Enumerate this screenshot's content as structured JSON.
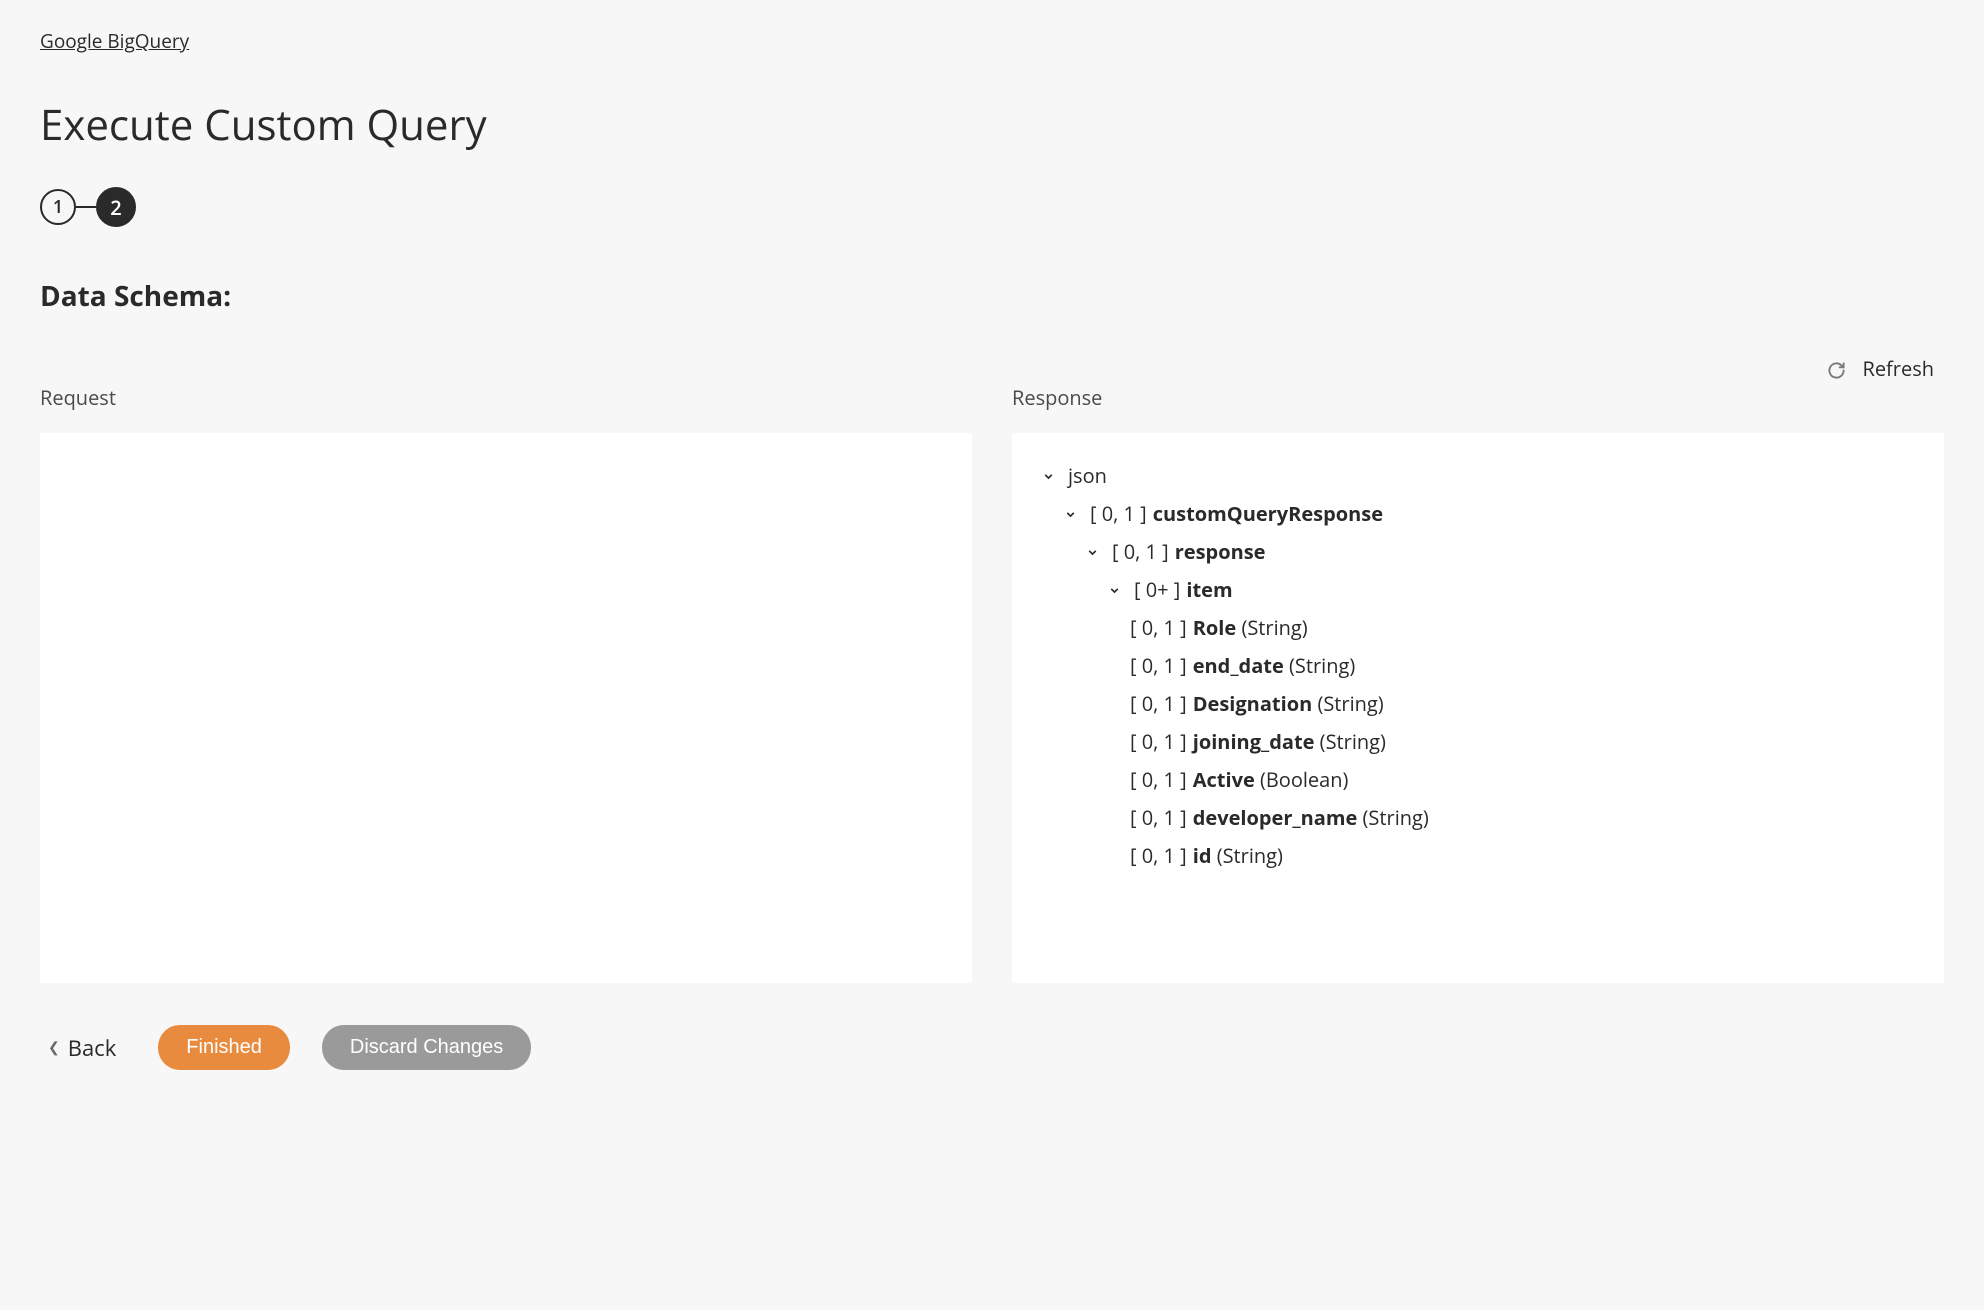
{
  "breadcrumb": "Google BigQuery",
  "page_title": "Execute Custom Query",
  "stepper": {
    "step1": "1",
    "step2": "2"
  },
  "section_title": "Data Schema:",
  "refresh_label": "Refresh",
  "panels": {
    "request_label": "Request",
    "response_label": "Response"
  },
  "tree": {
    "root": "json",
    "n1": {
      "card": "[ 0, 1 ]",
      "name": "customQueryResponse"
    },
    "n2": {
      "card": "[ 0, 1 ]",
      "name": "response"
    },
    "n3": {
      "card": "[ 0+ ]",
      "name": "item"
    },
    "f1": {
      "card": "[ 0, 1 ]",
      "name": "Role",
      "type": "(String)"
    },
    "f2": {
      "card": "[ 0, 1 ]",
      "name": "end_date",
      "type": "(String)"
    },
    "f3": {
      "card": "[ 0, 1 ]",
      "name": "Designation",
      "type": "(String)"
    },
    "f4": {
      "card": "[ 0, 1 ]",
      "name": "joining_date",
      "type": "(String)"
    },
    "f5": {
      "card": "[ 0, 1 ]",
      "name": "Active",
      "type": "(Boolean)"
    },
    "f6": {
      "card": "[ 0, 1 ]",
      "name": "developer_name",
      "type": "(String)"
    },
    "f7": {
      "card": "[ 0, 1 ]",
      "name": "id",
      "type": "(String)"
    }
  },
  "footer": {
    "back": "Back",
    "finished": "Finished",
    "discard": "Discard Changes"
  }
}
